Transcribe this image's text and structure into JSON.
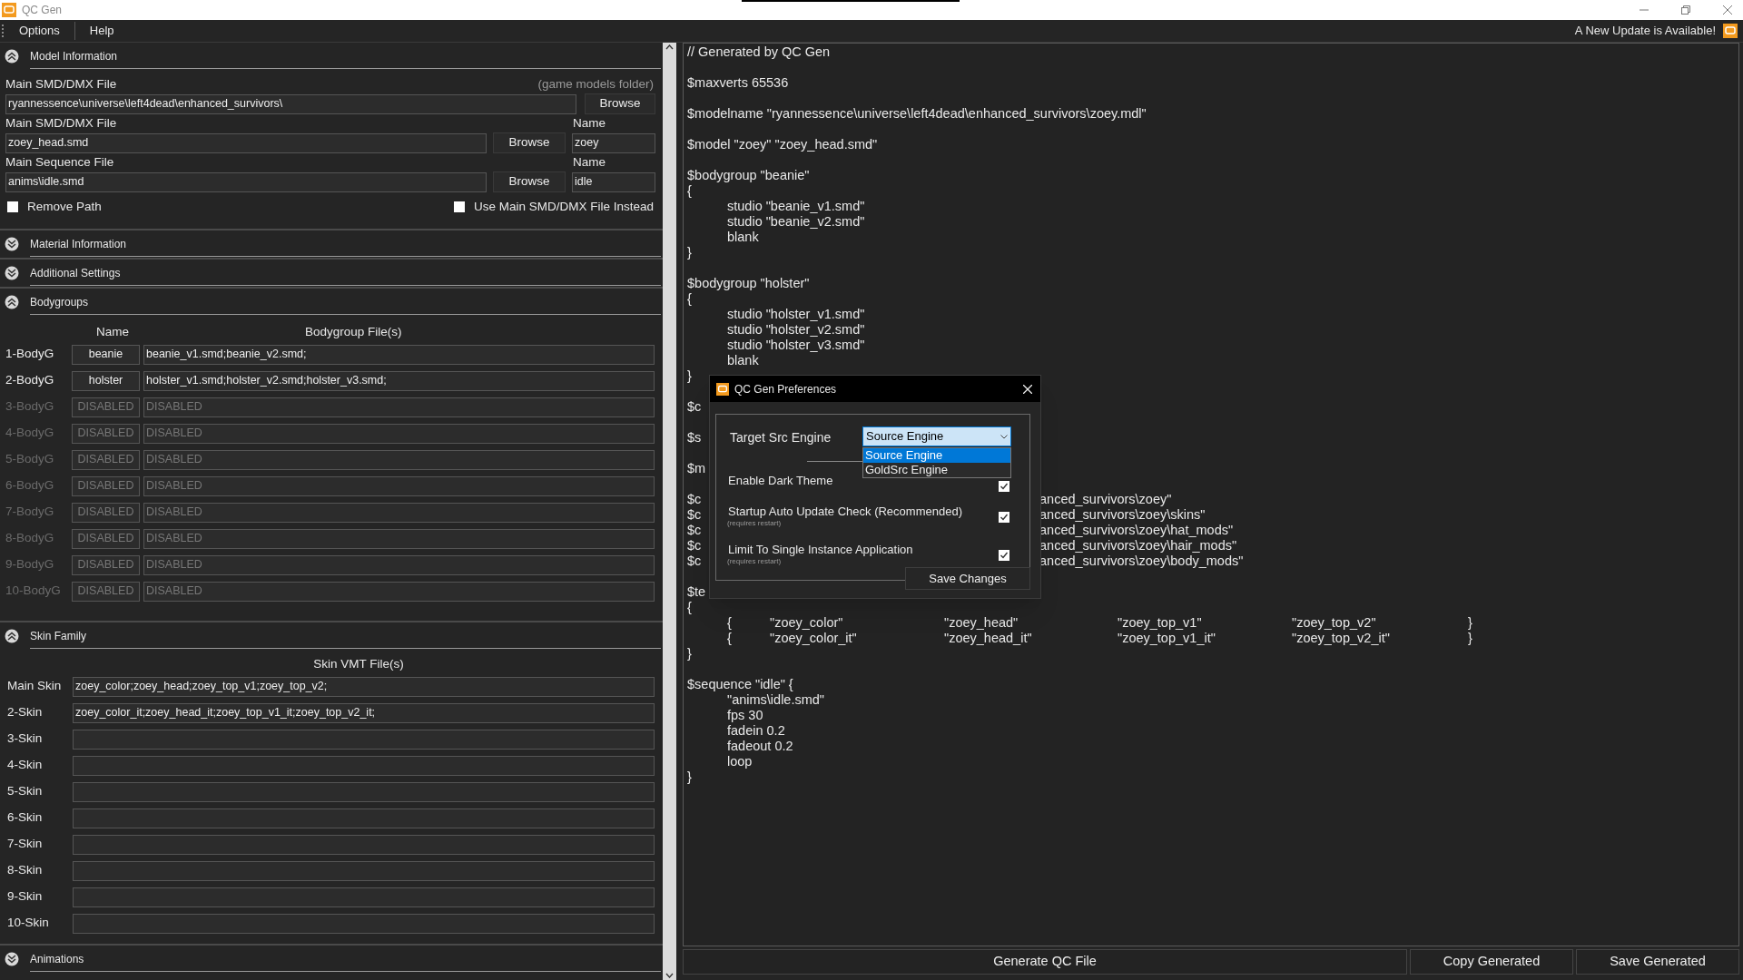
{
  "window": {
    "title": "QC Gen"
  },
  "menu": [
    "Options",
    "Help"
  ],
  "update_notice": "A New Update is Available!",
  "sections": [
    {
      "kind": "model",
      "title": "Model Information",
      "expanded": true,
      "models_folder": {
        "label": "Main SMD/DMX File",
        "hint": "(game models folder)",
        "value": "ryannessence\\universe\\left4dead\\enhanced_survivors\\",
        "button": "Browse"
      },
      "files": [
        {
          "label": "Main SMD/DMX File",
          "value": "zoey_head.smd",
          "button": "Browse",
          "name_label": "Name",
          "name_value": "zoey"
        },
        {
          "label": "Main Sequence File",
          "value": "anims\\idle.smd",
          "button": "Browse",
          "name_label": "Name",
          "name_value": "idle"
        }
      ],
      "options": [
        {
          "label": "Remove Path",
          "checked": false
        },
        {
          "label": "Use Main SMD/DMX File Instead",
          "checked": false
        }
      ]
    },
    {
      "title": "Material Information",
      "expanded": false
    },
    {
      "title": "Additional Settings",
      "expanded": false
    },
    {
      "kind": "bodygroups",
      "title": "Bodygroups",
      "expanded": true,
      "columns": [
        "Name",
        "Bodygroup File(s)"
      ],
      "rows": [
        {
          "label": "1-BodyG",
          "name": "beanie",
          "files": "beanie_v1.smd;beanie_v2.smd;",
          "disabled": false
        },
        {
          "label": "2-BodyG",
          "name": "holster",
          "files": "holster_v1.smd;holster_v2.smd;holster_v3.smd;",
          "disabled": false
        },
        {
          "label": "3-BodyG",
          "name": "DISABLED",
          "files": "DISABLED",
          "disabled": true
        },
        {
          "label": "4-BodyG",
          "name": "DISABLED",
          "files": "DISABLED",
          "disabled": true
        },
        {
          "label": "5-BodyG",
          "name": "DISABLED",
          "files": "DISABLED",
          "disabled": true
        },
        {
          "label": "6-BodyG",
          "name": "DISABLED",
          "files": "DISABLED",
          "disabled": true
        },
        {
          "label": "7-BodyG",
          "name": "DISABLED",
          "files": "DISABLED",
          "disabled": true
        },
        {
          "label": "8-BodyG",
          "name": "DISABLED",
          "files": "DISABLED",
          "disabled": true
        },
        {
          "label": "9-BodyG",
          "name": "DISABLED",
          "files": "DISABLED",
          "disabled": true
        },
        {
          "label": "10-BodyG",
          "name": "DISABLED",
          "files": "DISABLED",
          "disabled": true
        }
      ]
    },
    {
      "kind": "skins",
      "title": "Skin Family",
      "expanded": true,
      "column": "Skin VMT File(s)",
      "rows": [
        {
          "label": "Main Skin",
          "files": "zoey_color;zoey_head;zoey_top_v1;zoey_top_v2;"
        },
        {
          "label": "2-Skin",
          "files": "zoey_color_it;zoey_head_it;zoey_top_v1_it;zoey_top_v2_it;"
        },
        {
          "label": "3-Skin"
        },
        {
          "label": "4-Skin"
        },
        {
          "label": "5-Skin"
        },
        {
          "label": "6-Skin"
        },
        {
          "label": "7-Skin"
        },
        {
          "label": "8-Skin"
        },
        {
          "label": "9-Skin"
        },
        {
          "label": "10-Skin"
        }
      ]
    },
    {
      "title": "Animations",
      "expanded": false
    }
  ],
  "code": {
    "blocks": [
      [
        "// Generated by QC Gen"
      ],
      [
        "$maxverts 65536"
      ],
      [
        "$modelname \"ryannessence\\universe\\left4dead\\enhanced_survivors\\zoey.mdl\""
      ],
      [
        "$model \"zoey\" \"zoey_head.smd\""
      ],
      [
        "$bodygroup \"beanie\"",
        "{",
        "\tstudio \"beanie_v1.smd\"",
        "\tstudio \"beanie_v2.smd\"",
        "\tblank",
        "}"
      ],
      [
        "$bodygroup \"holster\"",
        "{",
        "\tstudio \"holster_v1.smd\"",
        "\tstudio \"holster_v2.smd\"",
        "\tstudio \"holster_v3.smd\"",
        "\tblank",
        "}"
      ],
      [
        "$c"
      ],
      [
        "$s"
      ],
      [
        "$m"
      ],
      [
        {
          "text": "$c",
          "tail": "anced_survivors\\zoey\""
        },
        {
          "text": "$c",
          "tail": "anced_survivors\\zoey\\skins\""
        },
        {
          "text": "$c",
          "tail": "anced_survivors\\zoey\\hat_mods\""
        },
        {
          "text": "$c",
          "tail": "anced_survivors\\zoey\\hair_mods\""
        },
        {
          "text": "$c",
          "tail": "anced_survivors\\zoey\\body_mods\""
        }
      ],
      [
        "$te",
        "{",
        {
          "cells": [
            "{",
            "\"zoey_color\"",
            "\"zoey_head\"",
            "\"zoey_top_v1\"",
            "\"zoey_top_v2\"",
            "}"
          ]
        },
        {
          "cells": [
            "{",
            "\"zoey_color_it\"",
            "\"zoey_head_it\"",
            "\"zoey_top_v1_it\"",
            "\"zoey_top_v2_it\"",
            "}"
          ]
        },
        "}"
      ],
      [
        "$sequence \"idle\" {",
        "\t\"anims\\idle.smd\"",
        "\tfps 30",
        "\tfadein 0.2",
        "\tfadeout 0.2",
        "\tloop",
        "}"
      ]
    ]
  },
  "buttons": [
    "Generate QC File",
    "Copy Generated",
    "Save Generated"
  ],
  "dialog": {
    "title": "QC Gen Preferences",
    "engine": {
      "label": "Target Src Engine",
      "value": "Source Engine",
      "expanded": true,
      "options": [
        {
          "label": "Source Engine",
          "selected": true
        },
        {
          "label": "GoldSrc Engine",
          "selected": false
        }
      ]
    },
    "settings": [
      {
        "label": "Enable Dark Theme",
        "checked": true
      },
      {
        "label": "Startup Auto Update Check (Recommended)",
        "note": "(requires restart)",
        "checked": true
      },
      {
        "label": "Limit To Single Instance Application",
        "note": "(requires restart)",
        "checked": true
      }
    ],
    "save_button": "Save Changes"
  }
}
